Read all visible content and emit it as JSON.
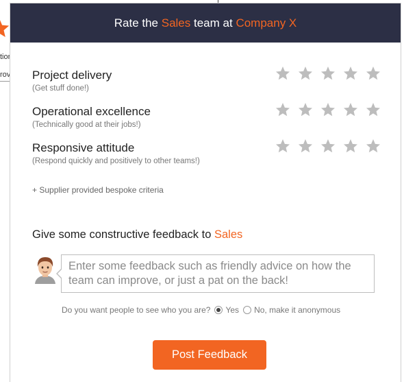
{
  "background": {
    "text_line1": "tion",
    "text_line2": "rov"
  },
  "header": {
    "prefix": "Rate the",
    "team": "Sales",
    "middle": "team at",
    "company": "Company X"
  },
  "criteria": [
    {
      "title": "Project delivery",
      "subtitle": "(Get stuff done!)",
      "rating": 0,
      "max": 5
    },
    {
      "title": "Operational excellence",
      "subtitle": "(Technically good at their jobs!)",
      "rating": 0,
      "max": 5
    },
    {
      "title": "Responsive attitude",
      "subtitle": "(Respond quickly and positively to other teams!)",
      "rating": 0,
      "max": 5
    }
  ],
  "bespoke_link": "+ Supplier provided bespoke criteria",
  "feedback": {
    "heading_prefix": "Give some constructive feedback to",
    "heading_team": "Sales",
    "placeholder": "Enter some feedback such as friendly advice on how the team can improve, or just a pat on the back!",
    "value": ""
  },
  "privacy": {
    "question": "Do you want people to see who you are?",
    "options": [
      {
        "label": "Yes",
        "selected": true
      },
      {
        "label": "No, make it anonymous",
        "selected": false
      }
    ]
  },
  "post_button": "Post Feedback",
  "colors": {
    "accent": "#f26522",
    "header_bg": "#2c2f45",
    "star_empty": "#bdbdbd"
  },
  "icons": {
    "star": "star-icon",
    "avatar": "user-avatar-icon"
  }
}
